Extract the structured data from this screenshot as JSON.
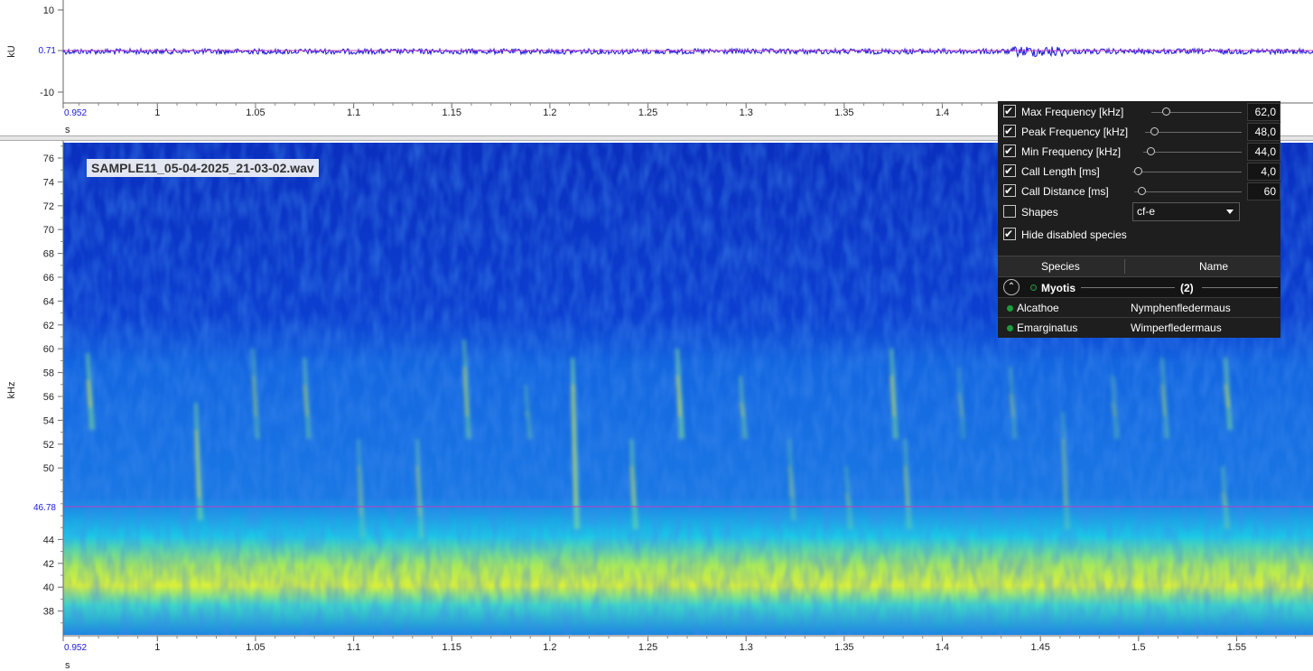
{
  "waveform": {
    "y_unit": "kU",
    "y_ticks": [
      "10",
      "0.71",
      "-10"
    ],
    "cursor_value": "0.71",
    "x_unit": "s",
    "x_ticks": [
      "0.952",
      "1",
      "1.05",
      "1.1",
      "1.15",
      "1.2",
      "1.25",
      "1.3",
      "1.35",
      "1.4"
    ],
    "trace_color": "#1515d8",
    "cursor_color": "#c03cc0"
  },
  "spectrogram": {
    "file_label": "SAMPLE11_05-04-2025_21-03-02.wav",
    "y_unit": "kHz",
    "y_ticks": [
      "76",
      "74",
      "72",
      "70",
      "68",
      "66",
      "64",
      "62",
      "60",
      "58",
      "56",
      "54",
      "52",
      "50",
      "44",
      "42",
      "40",
      "38"
    ],
    "cursor_value": "46.78",
    "x_unit": "s",
    "x_ticks": [
      "0.952",
      "1",
      "1.05",
      "1.1",
      "1.15",
      "1.2",
      "1.25",
      "1.3",
      "1.35",
      "1.4",
      "1.45",
      "1.5",
      "1.55"
    ],
    "colors": {
      "low": "#0a2fbf",
      "mid": "#1cc7e6",
      "high": "#f2ef1a"
    }
  },
  "panel": {
    "params": [
      {
        "label": "Max Frequency [kHz]",
        "checked": true,
        "value": "62,0",
        "level": 0.12
      },
      {
        "label": "Peak Frequency [kHz]",
        "checked": true,
        "value": "48,0",
        "level": 0.06
      },
      {
        "label": "Min Frequency [kHz]",
        "checked": true,
        "value": "44,0",
        "level": 0.04
      },
      {
        "label": "Call Length [ms]",
        "checked": true,
        "value": "4,0",
        "level": 0.02
      },
      {
        "label": "Call Distance [ms]",
        "checked": true,
        "value": "60",
        "level": 0.03
      }
    ],
    "shapes": {
      "label": "Shapes",
      "checked": false,
      "value": "cf-e"
    },
    "hide_disabled": {
      "label": "Hide disabled species",
      "checked": true
    },
    "table": {
      "col_species": "Species",
      "col_name": "Name",
      "group": {
        "name": "Myotis",
        "count": "(2)"
      },
      "rows": [
        {
          "species": "Alcathoe",
          "name": "Nymphenfledermaus"
        },
        {
          "species": "Emarginatus",
          "name": "Wimperfledermaus"
        }
      ]
    }
  }
}
